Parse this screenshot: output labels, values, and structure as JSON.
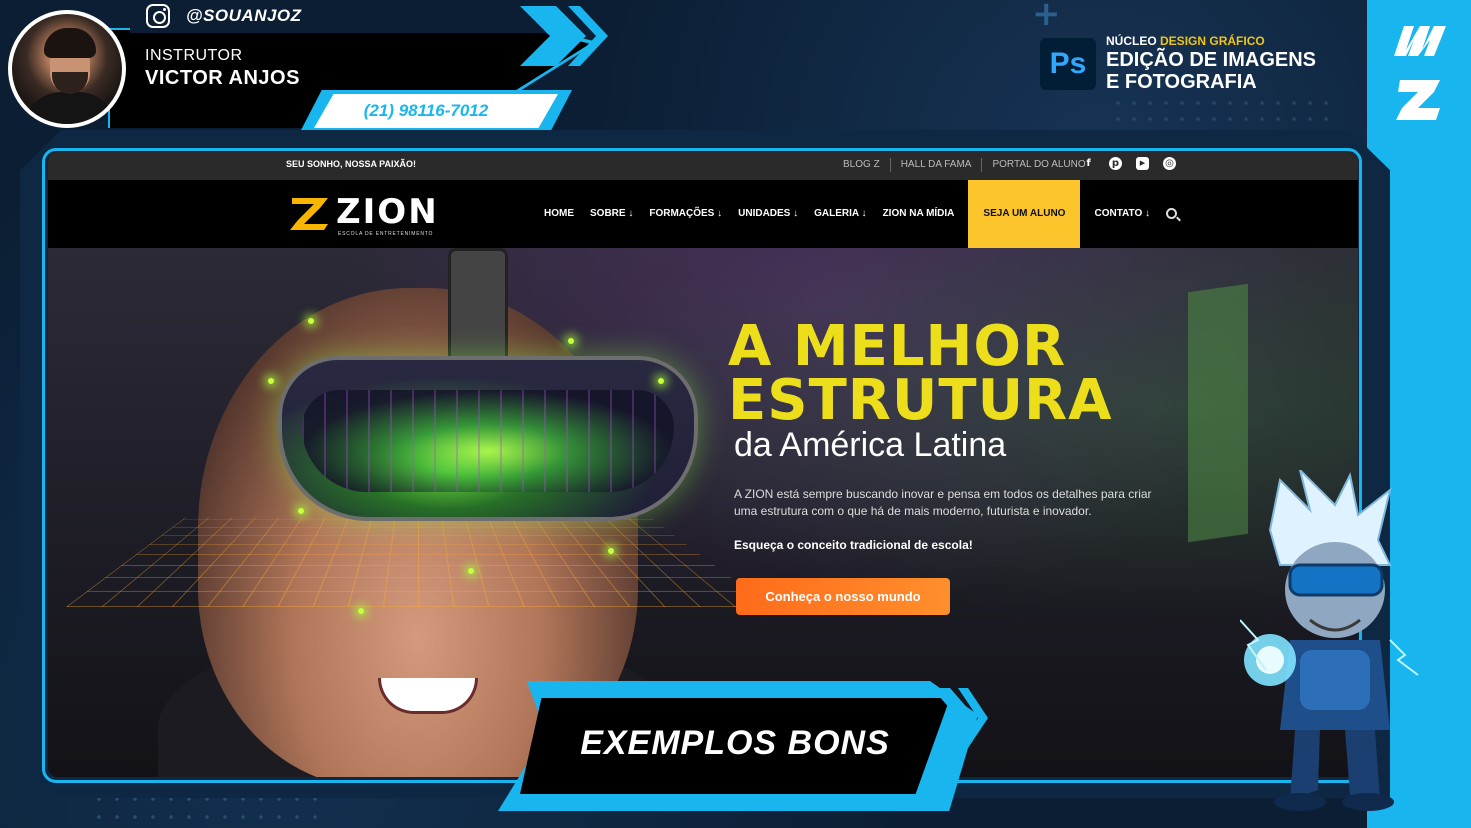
{
  "instructor": {
    "instagram_handle": "@SOUANJOZ",
    "label": "INSTRUTOR",
    "name": "VICTOR ANJOS",
    "phone": "(21) 98116-7012"
  },
  "course": {
    "app_badge": "Ps",
    "prefix": "NÚCLEO",
    "highlight": "DESIGN GRÁFICO",
    "title_line1": "EDIÇÃO DE IMAGENS",
    "title_line2": "E FOTOGRAFIA"
  },
  "site": {
    "slogan": "SEU SONHO, NOSSA PAIXÃO!",
    "top_links": [
      "BLOG Z",
      "HALL DA FAMA",
      "PORTAL DO ALUNO"
    ],
    "social_icons": [
      "facebook-icon",
      "pinterest-icon",
      "youtube-icon",
      "instagram-icon"
    ],
    "logo_word": "ZION",
    "logo_sub": "ESCOLA DE ENTRETENIMENTO",
    "nav": [
      "HOME",
      "SOBRE ↓",
      "FORMAÇÕES ↓",
      "UNIDADES ↓",
      "GALERIA ↓",
      "ZION NA MÍDIA",
      "SEJA UM ALUNO",
      "CONTATO ↓"
    ],
    "accent_color": "#fcc52b",
    "hero": {
      "title_line1": "A MELHOR",
      "title_line2": "ESTRUTURA",
      "subtitle": "da América Latina",
      "description": "A ZION está sempre buscando inovar e pensa em todos os detalhes para criar uma estrutura com o que há de mais moderno, futurista e inovador.",
      "strong": "Esqueça o conceito tradicional de escola!",
      "cta": "Conheça o nosso mundo",
      "title_color": "#ecde1b",
      "cta_color": "#ff7a1f"
    }
  },
  "banner": {
    "text": "EXEMPLOS BONS"
  },
  "theme": {
    "cyan": "#19b5ee",
    "navy": "#0b1e33"
  }
}
